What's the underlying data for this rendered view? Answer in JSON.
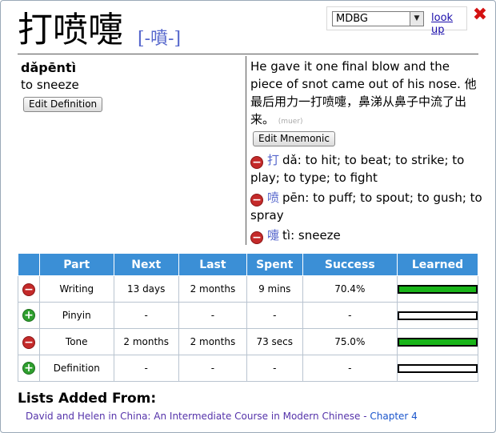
{
  "header": {
    "headword": "打喷嚏",
    "traditional": "[-噴-]",
    "dictionary_select": "MDBG",
    "lookup_label": "look up"
  },
  "entry": {
    "pinyin": "dǎpēntì",
    "definition": "to sneeze",
    "edit_definition_label": "Edit Definition"
  },
  "mnemonic": {
    "text": "He gave it one final blow and the piece of snot came out of his nose. 他最后用力一打喷嚏，鼻涕从鼻子中流了出来。",
    "credit": "(muer)",
    "edit_mnemonic_label": "Edit Mnemonic"
  },
  "components": [
    {
      "char": "打",
      "pinyin": "dǎ",
      "meaning": "to hit; to beat; to strike; to play; to type; to fight"
    },
    {
      "char": "喷",
      "pinyin": "pēn",
      "meaning": "to puff; to spout; to gush; to spray"
    },
    {
      "char": "嚏",
      "pinyin": "tì",
      "meaning": "sneeze"
    }
  ],
  "table": {
    "headers": [
      "Part",
      "Next",
      "Last",
      "Spent",
      "Success",
      "Learned"
    ],
    "rows": [
      {
        "action": "remove",
        "part": "Writing",
        "next": "13 days",
        "last": "2 months",
        "spent": "9 mins",
        "success": "70.4%",
        "learned": 1.0
      },
      {
        "action": "add",
        "part": "Pinyin",
        "next": "-",
        "last": "-",
        "spent": "-",
        "success": "-",
        "learned": 0
      },
      {
        "action": "remove",
        "part": "Tone",
        "next": "2 months",
        "last": "2 months",
        "spent": "73 secs",
        "success": "75.0%",
        "learned": 1.0
      },
      {
        "action": "add",
        "part": "Definition",
        "next": "-",
        "last": "-",
        "spent": "-",
        "success": "-",
        "learned": 0
      }
    ]
  },
  "lists": {
    "heading": "Lists Added From:",
    "book": "David and Helen in China: An Intermediate Course in Modern Chinese",
    "separator": "-",
    "chapter": "Chapter 4"
  },
  "colors": {
    "header_blue": "#3b8fd6",
    "bar_green": "#19b419",
    "remove_red": "#c42a2a",
    "add_green": "#2f9f2f"
  }
}
